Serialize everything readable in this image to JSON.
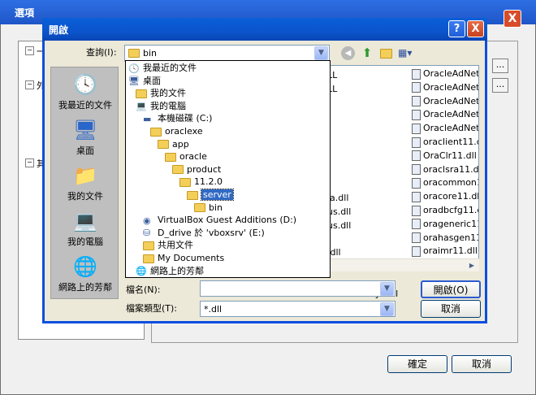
{
  "background_window": {
    "title": "選項",
    "close_glyph": "X",
    "tree": [
      {
        "mark": "−",
        "label": "一"
      },
      {
        "mark": "−",
        "label": "外"
      },
      {
        "mark": "−",
        "label": "其"
      }
    ],
    "browse_glyph": "...",
    "ok_label": "確定",
    "cancel_label": "取消"
  },
  "dialog": {
    "title": "開啟",
    "help_glyph": "?",
    "close_glyph": "X",
    "look_in": {
      "label": "查詢(I):",
      "value": "bin"
    },
    "places": [
      {
        "label": "我最近的文件",
        "icon": "recent-documents-icon"
      },
      {
        "label": "桌面",
        "icon": "desktop-icon"
      },
      {
        "label": "我的文件",
        "icon": "my-documents-icon"
      },
      {
        "label": "我的電腦",
        "icon": "my-computer-icon"
      },
      {
        "label": "網路上的芳鄰",
        "icon": "network-places-icon"
      }
    ],
    "dropdown_items": [
      {
        "label": "我最近的文件",
        "indent": 0,
        "icon": "recent-documents-icon"
      },
      {
        "label": "桌面",
        "indent": 0,
        "icon": "desktop-icon"
      },
      {
        "label": "我的文件",
        "indent": 1,
        "icon": "folder-icon"
      },
      {
        "label": "我的電腦",
        "indent": 1,
        "icon": "my-computer-icon"
      },
      {
        "label": "本機磁碟 (C:)",
        "indent": 2,
        "icon": "drive-icon"
      },
      {
        "label": "oraclexe",
        "indent": 3,
        "icon": "folder-icon"
      },
      {
        "label": "app",
        "indent": 4,
        "icon": "folder-icon"
      },
      {
        "label": "oracle",
        "indent": 5,
        "icon": "folder-icon"
      },
      {
        "label": "product",
        "indent": 6,
        "icon": "folder-icon"
      },
      {
        "label": "11.2.0",
        "indent": 7,
        "icon": "folder-icon"
      },
      {
        "label": "server",
        "indent": 8,
        "icon": "folder-icon",
        "selected": true
      },
      {
        "label": "bin",
        "indent": 9,
        "icon": "folder-icon"
      },
      {
        "label": "VirtualBox Guest Additions (D:)",
        "indent": 2,
        "icon": "cd-drive-icon"
      },
      {
        "label": "D_drive 於 'vboxsrv' (E:)",
        "indent": 2,
        "icon": "network-drive-icon"
      },
      {
        "label": "共用文件",
        "indent": 2,
        "icon": "folder-icon"
      },
      {
        "label": "My Documents",
        "indent": 2,
        "icon": "folder-icon"
      },
      {
        "label": "網路上的芳鄰",
        "indent": 1,
        "icon": "network-places-icon"
      }
    ],
    "files_col1_partial": [
      "LL",
      "LL",
      "",
      "",
      "",
      "",
      "",
      "",
      "",
      "ja.dll",
      "us.dll",
      "us.dll",
      "",
      ".dll",
      "",
      "",
      "ConnectRCJA.dll"
    ],
    "files_col2": [
      "OracleAdNetCo",
      "OracleAdNetCo",
      "OracleAdNetTe",
      "OracleAdNetTe",
      "OracleAdNetTe",
      "oraclient11.dll",
      "OraClr11.dll",
      "oraclsra11.dll",
      "oracommon11.",
      "oracore11.dll",
      "oradbcfg11.dll",
      "orageneric11.dll",
      "orahasgen11.dll",
      "oraimr11.dll"
    ],
    "filename": {
      "label": "檔名(N):",
      "value": ""
    },
    "filetype": {
      "label": "檔案類型(T):",
      "value": "*.dll"
    },
    "open_label": "開啟(O)",
    "cancel_label": "取消"
  },
  "colors": {
    "title_blue": "#0b54cc",
    "dialog_face": "#ece9d8",
    "places_bar": "#bfbfbf",
    "selection": "#316ac5"
  }
}
